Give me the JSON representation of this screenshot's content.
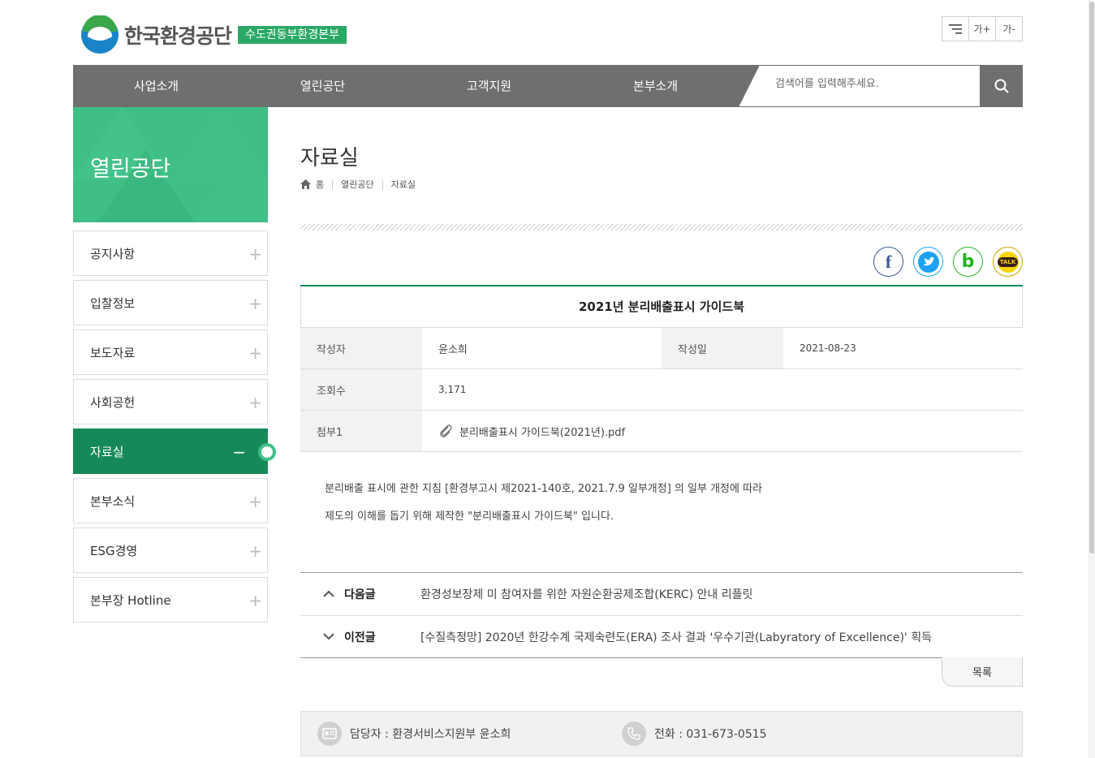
{
  "header": {
    "logo_name": "한국환경공단",
    "logo_sub": "수도권동부환경본부",
    "tools": [
      "",
      "가+",
      "가-"
    ]
  },
  "nav": {
    "items": [
      "사업소개",
      "열린공단",
      "고객지원",
      "본부소개"
    ],
    "search_placeholder": "검색어를 입력해주세요."
  },
  "sidebar": {
    "title": "열린공단",
    "items": [
      {
        "label": "공지사항",
        "state": "collapsed"
      },
      {
        "label": "입찰정보",
        "state": "collapsed"
      },
      {
        "label": "보도자료",
        "state": "collapsed"
      },
      {
        "label": "사회공헌",
        "state": "collapsed"
      },
      {
        "label": "자료실",
        "state": "active"
      },
      {
        "label": "본부소식",
        "state": "collapsed"
      },
      {
        "label": "ESG경영",
        "state": "collapsed"
      },
      {
        "label": "본부장 Hotline",
        "state": "collapsed"
      }
    ],
    "plus_symbol": "+",
    "minus_symbol": "−"
  },
  "main": {
    "title": "자료실",
    "breadcrumb": [
      "홈",
      "열린공단",
      "자료실"
    ],
    "sns": [
      {
        "name": "facebook",
        "glyph": "f",
        "color": "#3b5998"
      },
      {
        "name": "twitter",
        "glyph": "🐦",
        "color": "#1da1f2"
      },
      {
        "name": "band",
        "glyph": "b",
        "color": "#20b41f"
      },
      {
        "name": "kakaotalk",
        "glyph": "TALK",
        "color": "#c9a400"
      }
    ],
    "post": {
      "title": "2021년 분리배출표시 가이드북",
      "author_label": "작성자",
      "author": "윤소희",
      "date_label": "작성일",
      "date": "2021-08-23",
      "views_label": "조회수",
      "views": "3,171",
      "attach_label": "첨부1",
      "attach_name": "분리배출표시 가이드북(2021년).pdf",
      "body": [
        "분리배출 표시에 관한 지침 [환경부고시 제2021-140호, 2021.7.9 일부개정] 의 일부 개정에 따라",
        "제도의 이해를 돕기 위해 제작한 \"분리배출표시 가이드북\" 입니다."
      ]
    },
    "next": {
      "label": "다음글",
      "title": "환경성보장제 미 참여자를 위한 자원순환공제조합(KERC) 안내 리플릿"
    },
    "prev": {
      "label": "이전글",
      "title": "[수질측정망] 2020년 한강수계 국제숙련도(ERA) 조사 결과 '우수기관(Labyratory of Excellence)' 획득"
    },
    "list_button": "목록",
    "contact": {
      "person": "담당자 : 환경서비스지원부 윤소희",
      "phone": "전화 : 031-673-0515"
    }
  }
}
